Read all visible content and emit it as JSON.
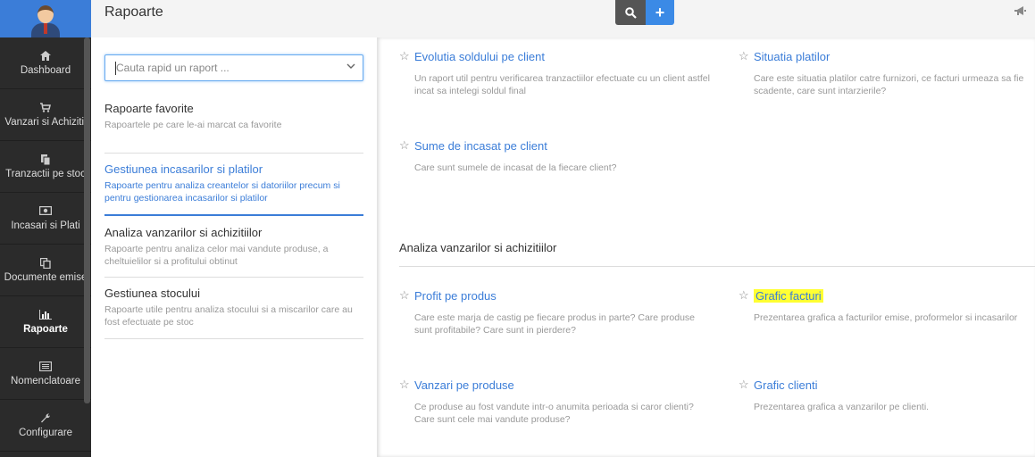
{
  "header": {
    "title": "Rapoarte"
  },
  "sidebar": {
    "items": [
      {
        "label": "Dashboard",
        "icon": "home-icon"
      },
      {
        "label": "Vanzari si Achizitii",
        "icon": "cart-icon"
      },
      {
        "label": "Tranzactii pe stoc",
        "icon": "documents-icon"
      },
      {
        "label": "Incasari si Plati",
        "icon": "money-icon"
      },
      {
        "label": "Documente emise",
        "icon": "copy-icon"
      },
      {
        "label": "Rapoarte",
        "icon": "bar-chart-icon",
        "active": true
      },
      {
        "label": "Nomenclatoare",
        "icon": "list-icon"
      },
      {
        "label": "Configurare",
        "icon": "wrench-icon"
      }
    ]
  },
  "search": {
    "placeholder": "Cauta rapid un raport ..."
  },
  "categories": [
    {
      "title": "Rapoarte favorite",
      "desc": "Rapoartele pe care le-ai marcat ca favorite"
    },
    {
      "title": "Gestiunea incasarilor si platilor",
      "desc": "Rapoarte pentru analiza creantelor si datoriilor precum si pentru gestionarea incasarilor si platilor",
      "active": true
    },
    {
      "title": "Analiza vanzarilor si achizitiilor",
      "desc": "Rapoarte pentru analiza celor mai vandute produse, a cheltuielilor si a profitului obtinut"
    },
    {
      "title": "Gestiunea stocului",
      "desc": "Rapoarte utile pentru analiza stocului si a miscarilor care au fost efectuate pe stoc"
    }
  ],
  "reports": [
    {
      "title": "Evolutia soldului pe client",
      "desc": "Un raport util pentru verificarea tranzactiilor efectuate cu un client astfel incat sa intelegi soldul final"
    },
    {
      "title": "Situatia platilor",
      "desc": "Care este situatia platilor catre furnizori, ce facturi urmeaza sa fie scadente, care sunt intarzierile?"
    },
    {
      "title": "Sume de incasat pe client",
      "desc": "Care sunt sumele de incasat de la fiecare client?"
    },
    {
      "title": "Profit pe produs",
      "desc": "Care este marja de castig pe fiecare produs in parte? Care produse sunt profitabile? Care sunt in pierdere?"
    },
    {
      "title": "Grafic facturi",
      "desc": "Prezentarea grafica a facturilor emise, proformelor si incasarilor",
      "highlighted": true
    },
    {
      "title": "Vanzari pe produse",
      "desc": "Ce produse au fost vandute intr-o anumita perioada si caror clienti? Care sunt cele mai vandute produse?"
    },
    {
      "title": "Grafic clienti",
      "desc": "Prezentarea grafica a vanzarilor pe clienti."
    }
  ],
  "section": {
    "title": "Analiza vanzarilor si achizitiilor"
  },
  "colors": {
    "accent": "#3b7dd8",
    "sidebar": "#2b2b2b",
    "highlight": "#ffff33"
  }
}
